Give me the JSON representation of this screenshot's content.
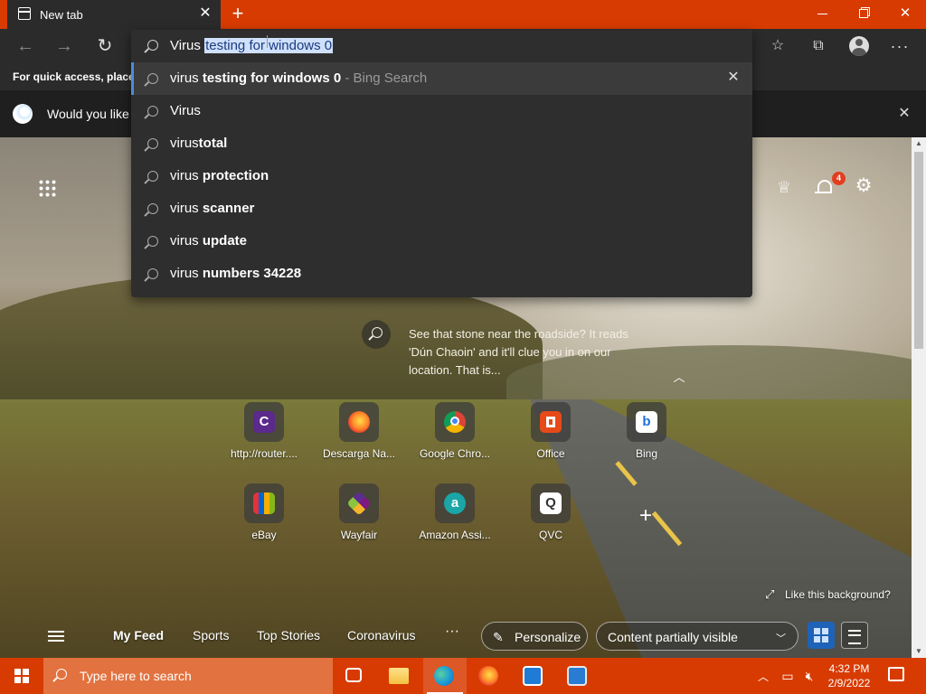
{
  "browser": {
    "tab": {
      "title": "New tab",
      "close_label": "✕"
    },
    "new_tab_label": "+",
    "window_controls": {
      "close_label": "✕"
    }
  },
  "address": {
    "typed": "Virus",
    "autocomplete": "testing for windows 0",
    "suggestions": [
      {
        "prefix": "virus",
        "bold": "testing for windows 0",
        "source": " - Bing Search",
        "active": true
      },
      {
        "prefix": "Virus",
        "bold": "",
        "source": ""
      },
      {
        "prefix": "virus",
        "bold": "total",
        "source": ""
      },
      {
        "prefix": "virus",
        "bold": " protection",
        "source": ""
      },
      {
        "prefix": "virus",
        "bold": " scanner",
        "source": ""
      },
      {
        "prefix": "virus",
        "bold": " update",
        "source": ""
      },
      {
        "prefix": "virus",
        "bold": " numbers 34228",
        "source": ""
      }
    ]
  },
  "favorites_bar": {
    "text": "For quick access, place y"
  },
  "banner": {
    "text": "Would you like t"
  },
  "ntp": {
    "notification_count": "4",
    "image_info": "See that stone near the roadside? It reads 'Dún Chaoin' and it'll clue you in on our location. That is...",
    "tiles": [
      {
        "label": "http://router....",
        "glyph": "C",
        "color": "#6b2fa3"
      },
      {
        "label": "Descarga Na...",
        "glyph": "",
        "color": "#ff7b1c"
      },
      {
        "label": "Google Chro...",
        "glyph": "",
        "color": "#dd4b39"
      },
      {
        "label": "Office",
        "glyph": "",
        "color": "#e64a19"
      },
      {
        "label": "Bing",
        "glyph": "b",
        "color": "#ffffff"
      },
      {
        "label": "eBay",
        "glyph": "",
        "color": "#2e8b57"
      },
      {
        "label": "Wayfair",
        "glyph": "",
        "color": "#7f3fbf"
      },
      {
        "label": "Amazon Assi...",
        "glyph": "a",
        "color": "#1aa6a6"
      },
      {
        "label": "QVC",
        "glyph": "Q",
        "color": "#ffffff"
      }
    ],
    "like_background": "Like this background?",
    "feed": {
      "tabs": [
        "My Feed",
        "Sports",
        "Top Stories",
        "Coronavirus"
      ],
      "more": "···",
      "personalize": "Personalize",
      "content_visibility": "Content partially visible"
    }
  },
  "taskbar": {
    "search_placeholder": "Type here to search",
    "time": "4:32 PM",
    "date": "2/9/2022"
  }
}
